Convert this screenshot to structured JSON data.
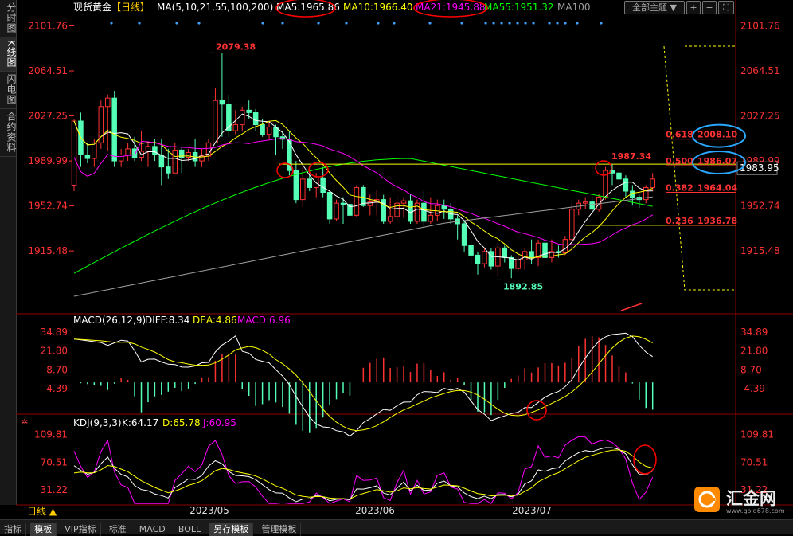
{
  "left_tabs": [
    "分时图",
    "K线图",
    "闪电图",
    "合约资料"
  ],
  "active_tab_index": 1,
  "header": {
    "instrument": "现货黄金",
    "period": "【日线】",
    "ma_label": "MA(5,10,21,55,100,200)",
    "ma_values": [
      {
        "label": "MA5:1965.86",
        "color": "#ffffff"
      },
      {
        "label": "MA10:1966.40",
        "color": "#ffff00"
      },
      {
        "label": "MA21:1945.88",
        "color": "#ff00ff"
      },
      {
        "label": "MA55:1951.32",
        "color": "#00ff00"
      },
      {
        "label": "MA100",
        "color": "#a0a0a0"
      }
    ],
    "theme_button": "全部主题",
    "theme_arrow": "▼"
  },
  "colors": {
    "up": "#ff3232",
    "down": "#54ffb6",
    "axis": "#ff3232",
    "fib": "#ffff00",
    "ma5": "#ffffff",
    "ma10": "#ffff00",
    "ma21": "#ff00ff",
    "ma55": "#00ff00",
    "ma100": "#a0a0a0"
  },
  "chart_data": {
    "type": "candlestick",
    "dates_visible": [
      "2023/05",
      "2023/06",
      "2023/07"
    ],
    "ylim": [
      1878,
      2110
    ],
    "yticks": [
      "2101.76",
      "2064.51",
      "2027.25",
      "1989.99",
      "1952.74",
      "1915.48"
    ],
    "candles": [
      [
        1970,
        2023,
        2025,
        1965
      ],
      [
        2023,
        1995,
        2030,
        1985
      ],
      [
        1995,
        1992,
        2005,
        1988
      ],
      [
        1992,
        2005,
        2008,
        1985
      ],
      [
        2005,
        2035,
        2040,
        2000
      ],
      [
        2035,
        2042,
        2045,
        1998
      ],
      [
        2042,
        1990,
        2048,
        1985
      ],
      [
        1990,
        1995,
        2000,
        1985
      ],
      [
        1995,
        2000,
        2005,
        1990
      ],
      [
        2000,
        1993,
        2010,
        1990
      ],
      [
        1993,
        1998,
        2015,
        1990
      ],
      [
        1998,
        2002,
        2005,
        1985
      ],
      [
        2002,
        1995,
        2008,
        1990
      ],
      [
        1995,
        1985,
        2008,
        1970
      ],
      [
        1985,
        1980,
        2000,
        1975
      ],
      [
        1980,
        1999,
        2005,
        1980
      ],
      [
        1999,
        1993,
        2002,
        1980
      ],
      [
        1993,
        1997,
        2000,
        1990
      ],
      [
        1997,
        1990,
        2008,
        1985
      ],
      [
        1990,
        1994,
        2000,
        1985
      ],
      [
        1994,
        2005,
        2008,
        1990
      ],
      [
        2005,
        2040,
        2050,
        2005
      ],
      [
        2040,
        2037,
        2079,
        2010
      ],
      [
        2037,
        2015,
        2045,
        2010
      ],
      [
        2015,
        2020,
        2032,
        2012
      ],
      [
        2020,
        2032,
        2035,
        2015
      ],
      [
        2032,
        2030,
        2040,
        2025
      ],
      [
        2030,
        2020,
        2033,
        2015
      ],
      [
        2020,
        2012,
        2025,
        2010
      ],
      [
        2012,
        2018,
        2023,
        2008
      ],
      [
        2018,
        2010,
        2020,
        1995
      ],
      [
        2010,
        2008,
        2015,
        2000
      ],
      [
        2008,
        1982,
        2015,
        1978
      ],
      [
        1982,
        1958,
        1990,
        1955
      ],
      [
        1958,
        1975,
        1985,
        1952
      ],
      [
        1975,
        1968,
        1983,
        1965
      ],
      [
        1968,
        1976,
        1980,
        1960
      ],
      [
        1976,
        1964,
        1985,
        1960
      ],
      [
        1964,
        1942,
        1966,
        1938
      ],
      [
        1942,
        1955,
        1958,
        1940
      ],
      [
        1955,
        1954,
        1960,
        1938
      ],
      [
        1954,
        1945,
        1958,
        1943
      ],
      [
        1945,
        1968,
        1970,
        1944
      ],
      [
        1968,
        1953,
        1970,
        1952
      ],
      [
        1953,
        1956,
        1962,
        1945
      ],
      [
        1956,
        1958,
        1966,
        1945
      ],
      [
        1958,
        1940,
        1962,
        1938
      ],
      [
        1940,
        1944,
        1960,
        1938
      ],
      [
        1944,
        1955,
        1962,
        1940
      ],
      [
        1955,
        1957,
        1960,
        1943
      ],
      [
        1957,
        1940,
        1962,
        1938
      ],
      [
        1940,
        1955,
        1958,
        1938
      ],
      [
        1955,
        1940,
        1965,
        1935
      ],
      [
        1940,
        1945,
        1960,
        1938
      ],
      [
        1945,
        1953,
        1958,
        1940
      ],
      [
        1953,
        1950,
        1958,
        1942
      ],
      [
        1950,
        1942,
        1955,
        1938
      ],
      [
        1942,
        1938,
        1945,
        1925
      ],
      [
        1938,
        1920,
        1940,
        1915
      ],
      [
        1920,
        1912,
        1925,
        1905
      ],
      [
        1912,
        1905,
        1915,
        1896
      ],
      [
        1905,
        1915,
        1918,
        1902
      ],
      [
        1915,
        1903,
        1918,
        1900
      ],
      [
        1903,
        1918,
        1922,
        1895
      ],
      [
        1918,
        1910,
        1920,
        1906
      ],
      [
        1910,
        1901,
        1912,
        1893
      ],
      [
        1901,
        1908,
        1915,
        1899
      ],
      [
        1908,
        1915,
        1918,
        1900
      ],
      [
        1915,
        1910,
        1925,
        1905
      ],
      [
        1910,
        1922,
        1925,
        1903
      ],
      [
        1922,
        1910,
        1925,
        1903
      ],
      [
        1910,
        1915,
        1925,
        1906
      ],
      [
        1915,
        1914,
        1920,
        1910
      ],
      [
        1914,
        1925,
        1928,
        1912
      ],
      [
        1925,
        1950,
        1955,
        1915
      ],
      [
        1950,
        1955,
        1958,
        1945
      ],
      [
        1955,
        1956,
        1960,
        1950
      ],
      [
        1956,
        1950,
        1960,
        1948
      ],
      [
        1950,
        1960,
        1963,
        1948
      ],
      [
        1960,
        1982,
        1985,
        1958
      ],
      [
        1982,
        1980,
        1987,
        1970
      ],
      [
        1980,
        1975,
        1985,
        1966
      ],
      [
        1975,
        1965,
        1978,
        1960
      ],
      [
        1965,
        1960,
        1970,
        1953
      ],
      [
        1960,
        1958,
        1962,
        1951
      ],
      [
        1958,
        1968,
        1970,
        1955
      ],
      [
        1968,
        1975,
        1980,
        1965
      ]
    ],
    "annotations": {
      "high": "2079.38",
      "low": "1892.85",
      "recent_high": "1987.34",
      "current_price": "1983.95"
    },
    "fib_levels": [
      {
        "ratio": "0.618",
        "price": "2008.10",
        "value": 2008.1
      },
      {
        "ratio": "0.500",
        "price": "1986.07",
        "value": 1986.07
      },
      {
        "ratio": "0.382",
        "price": "1964.04",
        "value": 1964.04
      },
      {
        "ratio": "0.236",
        "price": "1936.78",
        "value": 1936.78
      }
    ],
    "resistance_level": 1987.34,
    "support_level": 1936.78,
    "macd": {
      "label": "MACD(26,12,9)",
      "diff_label": "DIFF:8.34",
      "dea_label": "DEA:4.86",
      "macd_label": "MACD:6.96",
      "ylim": [
        -22,
        42
      ],
      "yticks": [
        "34.89",
        "21.80",
        "8.70",
        "-4.39"
      ]
    },
    "kdj": {
      "label": "KDJ(9,3,3)",
      "k_label": "K:64.17",
      "d_label": "D:65.78",
      "j_label": "J:60.95",
      "ylim": [
        10,
        125
      ],
      "yticks": [
        "109.81",
        "70.51",
        "31.22"
      ]
    }
  },
  "period_tab": {
    "label": "日线",
    "arrow": "▲"
  },
  "bottom_tabs": [
    "指标",
    "模板",
    "VIP指标",
    "标准",
    "MACD",
    "BOLL",
    "另存模板",
    "管理模板"
  ],
  "active_bottom_tab": 1,
  "logo": {
    "text": "汇金网",
    "site": "www.gold678.com"
  }
}
